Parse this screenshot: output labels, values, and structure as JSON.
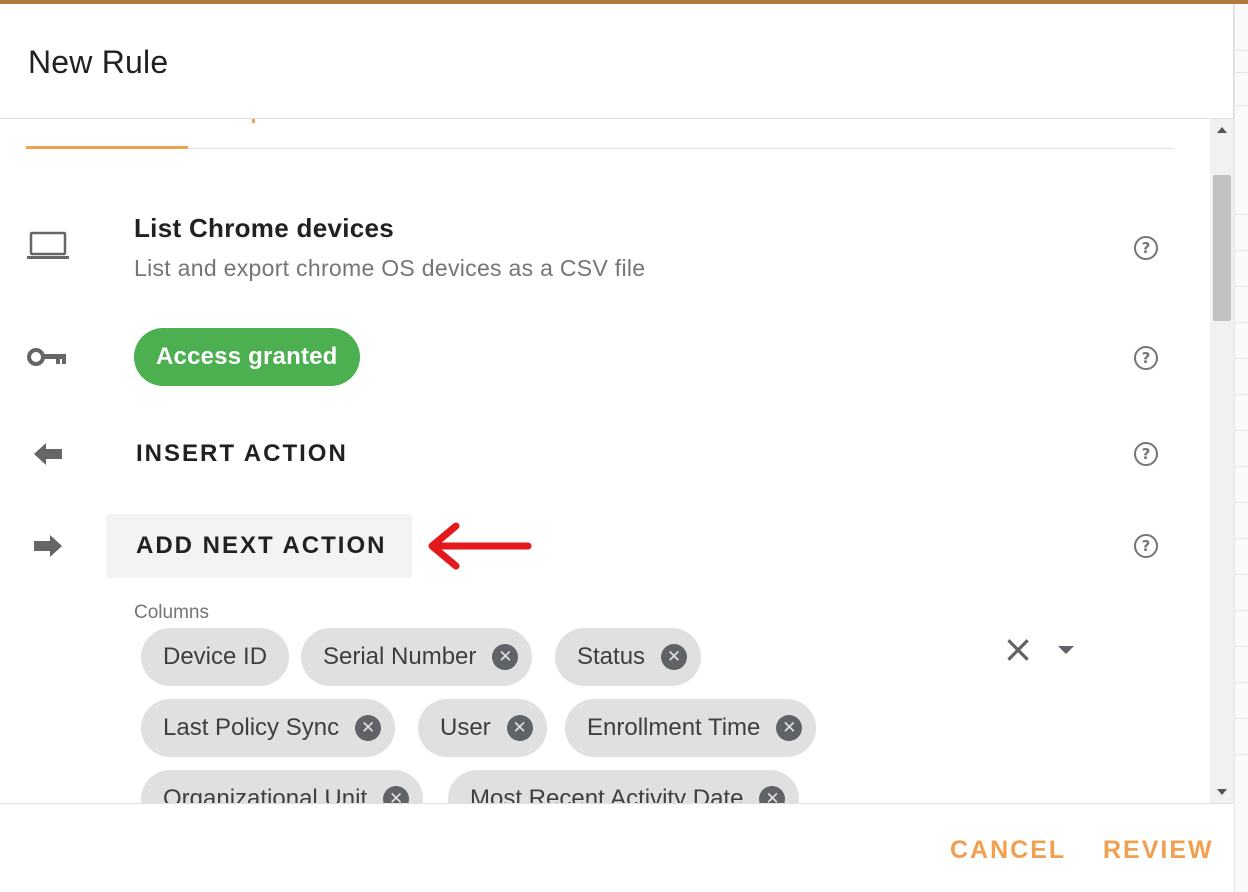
{
  "dialog": {
    "title": "New Rule"
  },
  "rule": {
    "name": "List Chrome devices",
    "description": "List and export chrome OS devices as a CSV file"
  },
  "access": {
    "status": "Access granted",
    "color": "#4caf50"
  },
  "actions": {
    "insert": "INSERT ACTION",
    "add_next": "ADD NEXT ACTION"
  },
  "columns": {
    "label": "Columns",
    "chips": [
      "Device ID",
      "Serial Number",
      "Status",
      "Last Policy Sync",
      "User",
      "Enrollment Time",
      "Organizational Unit",
      "Most Recent Activity Date"
    ]
  },
  "icons": {
    "device": "laptop-icon",
    "access": "key-icon",
    "insert": "arrow-left-icon",
    "next": "arrow-right-icon",
    "help": "help-circle-icon",
    "annotation": "red-arrow-icon"
  },
  "footer": {
    "cancel": "CANCEL",
    "review": "REVIEW"
  },
  "accent_color": "#f0a050"
}
